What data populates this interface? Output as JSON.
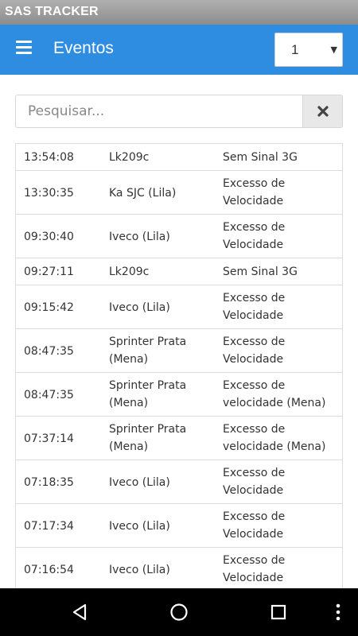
{
  "status_bar": {
    "title": "SAS TRACKER"
  },
  "app_bar": {
    "title": "Eventos",
    "page_select_value": "1"
  },
  "search": {
    "placeholder": "Pesquisar...",
    "value": ""
  },
  "events": [
    {
      "time": "13:54:08",
      "vehicle": "Lk209c",
      "event": "Sem Sinal 3G"
    },
    {
      "time": "13:30:35",
      "vehicle": "Ka SJC (Lila)",
      "event": "Excesso de Velocidade"
    },
    {
      "time": "09:30:40",
      "vehicle": "Iveco (Lila)",
      "event": "Excesso de Velocidade"
    },
    {
      "time": "09:27:11",
      "vehicle": "Lk209c",
      "event": "Sem Sinal 3G"
    },
    {
      "time": "09:15:42",
      "vehicle": "Iveco (Lila)",
      "event": "Excesso de Velocidade"
    },
    {
      "time": "08:47:35",
      "vehicle": "Sprinter Prata (Mena)",
      "event": "Excesso de Velocidade"
    },
    {
      "time": "08:47:35",
      "vehicle": "Sprinter Prata (Mena)",
      "event": "Excesso de velocidade (Mena)"
    },
    {
      "time": "07:37:14",
      "vehicle": "Sprinter Prata (Mena)",
      "event": "Excesso de velocidade (Mena)"
    },
    {
      "time": "07:18:35",
      "vehicle": "Iveco (Lila)",
      "event": "Excesso de Velocidade"
    },
    {
      "time": "07:17:34",
      "vehicle": "Iveco (Lila)",
      "event": "Excesso de Velocidade"
    },
    {
      "time": "07:16:54",
      "vehicle": "Iveco (Lila)",
      "event": "Excesso de Velocidade"
    }
  ],
  "nav_bar": {
    "icons": [
      "back-icon",
      "home-icon",
      "recents-icon",
      "more-vertical-icon"
    ]
  },
  "colors": {
    "app_bar": "#2f8de1",
    "status_bar": "#9e9e9e",
    "nav_bar": "#000000"
  }
}
